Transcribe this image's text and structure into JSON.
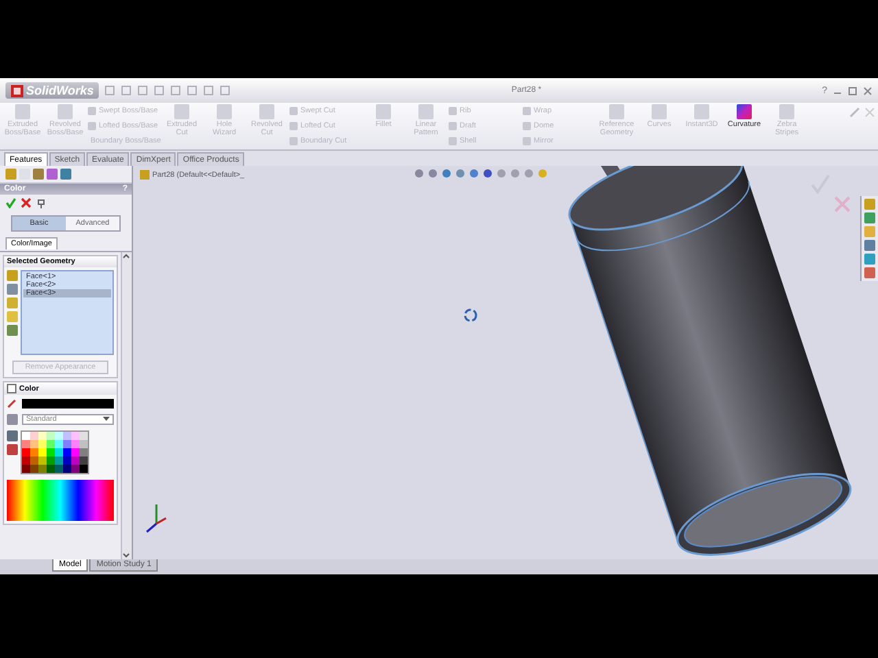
{
  "window": {
    "app_name": "SolidWorks",
    "title": "Part28 *",
    "help": "?"
  },
  "ribbon": {
    "columns": [
      {
        "kind": "large",
        "tools": [
          {
            "label": "Extruded Boss/Base",
            "disabled": true
          }
        ]
      },
      {
        "kind": "large",
        "tools": [
          {
            "label": "Revolved Boss/Base",
            "disabled": true
          }
        ]
      },
      {
        "kind": "stack",
        "tools": [
          {
            "label": "Swept Boss/Base",
            "disabled": true
          },
          {
            "label": "Lofted Boss/Base",
            "disabled": true
          },
          {
            "label": "Boundary Boss/Base",
            "disabled": true
          }
        ]
      },
      {
        "kind": "large",
        "tools": [
          {
            "label": "Extruded Cut",
            "disabled": true
          }
        ]
      },
      {
        "kind": "large",
        "tools": [
          {
            "label": "Hole Wizard",
            "disabled": true
          }
        ]
      },
      {
        "kind": "large",
        "tools": [
          {
            "label": "Revolved Cut",
            "disabled": true
          }
        ]
      },
      {
        "kind": "stack",
        "tools": [
          {
            "label": "Swept Cut",
            "disabled": true
          },
          {
            "label": "Lofted Cut",
            "disabled": true
          },
          {
            "label": "Boundary Cut",
            "disabled": true
          }
        ]
      },
      {
        "kind": "large",
        "tools": [
          {
            "label": "Fillet",
            "disabled": true
          }
        ]
      },
      {
        "kind": "large",
        "tools": [
          {
            "label": "Linear Pattern",
            "disabled": true
          }
        ]
      },
      {
        "kind": "stack",
        "tools": [
          {
            "label": "Rib",
            "disabled": true
          },
          {
            "label": "Draft",
            "disabled": true
          },
          {
            "label": "Shell",
            "disabled": true
          }
        ]
      },
      {
        "kind": "stack",
        "tools": [
          {
            "label": "Wrap",
            "disabled": true
          },
          {
            "label": "Dome",
            "disabled": true
          },
          {
            "label": "Mirror",
            "disabled": true
          }
        ]
      },
      {
        "kind": "large",
        "tools": [
          {
            "label": "Reference Geometry",
            "disabled": true
          }
        ]
      },
      {
        "kind": "large",
        "tools": [
          {
            "label": "Curves",
            "disabled": true
          }
        ]
      },
      {
        "kind": "large",
        "tools": [
          {
            "label": "Instant3D",
            "disabled": true
          }
        ]
      },
      {
        "kind": "large",
        "tools": [
          {
            "label": "Curvature",
            "disabled": false
          }
        ]
      },
      {
        "kind": "large",
        "tools": [
          {
            "label": "Zebra Stripes",
            "disabled": true
          }
        ]
      }
    ]
  },
  "tabs": [
    {
      "label": "Features",
      "selected": true
    },
    {
      "label": "Sketch",
      "selected": false
    },
    {
      "label": "Evaluate",
      "selected": false
    },
    {
      "label": "DimXpert",
      "selected": false
    },
    {
      "label": "Office Products",
      "selected": false
    }
  ],
  "property_manager": {
    "title": "Color",
    "help": "?",
    "modes": [
      {
        "label": "Basic",
        "selected": true
      },
      {
        "label": "Advanced",
        "selected": false
      }
    ],
    "subtab": "Color/Image",
    "selected_geometry": {
      "heading": "Selected Geometry",
      "items": [
        {
          "label": "Face<1>",
          "selected": false
        },
        {
          "label": "Face<2>",
          "selected": false
        },
        {
          "label": "Face<3>",
          "selected": true
        }
      ],
      "remove_button": {
        "label": "Remove Appearance",
        "disabled": true
      }
    },
    "color_section": {
      "heading": "Color",
      "checked": false,
      "palette": "Standard"
    }
  },
  "tree": {
    "root": "Part28  (Default<<Default>_"
  },
  "bottom_tabs": [
    {
      "label": "Model",
      "selected": true
    },
    {
      "label": "Motion Study 1",
      "selected": false
    }
  ]
}
